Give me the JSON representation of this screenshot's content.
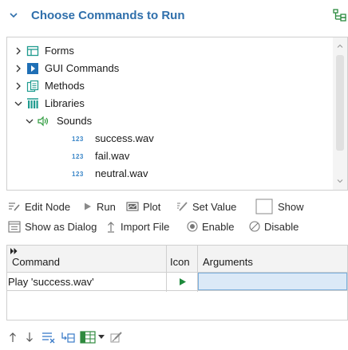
{
  "header": {
    "title": "Choose Commands to Run"
  },
  "tree": {
    "items": [
      {
        "label": "Forms",
        "icon": "forms-icon",
        "expanded": false
      },
      {
        "label": "GUI Commands",
        "icon": "gui-commands-icon",
        "expanded": false
      },
      {
        "label": "Methods",
        "icon": "methods-icon",
        "expanded": false
      },
      {
        "label": "Libraries",
        "icon": "libraries-icon",
        "expanded": true
      },
      {
        "label": "Sounds",
        "icon": "sounds-icon",
        "expanded": true
      },
      {
        "label": "success.wav",
        "badge": "123"
      },
      {
        "label": "fail.wav",
        "badge": "123"
      },
      {
        "label": "neutral.wav",
        "badge": "123"
      }
    ]
  },
  "toolbar": {
    "edit_node": "Edit Node",
    "run": "Run",
    "plot": "Plot",
    "set_value": "Set Value",
    "show": "Show",
    "show_as_dialog": "Show as Dialog",
    "import_file": "Import File",
    "enable": "Enable",
    "disable": "Disable"
  },
  "grid": {
    "columns": [
      "Command",
      "Icon",
      "Arguments"
    ],
    "rows": [
      {
        "command": "Play 'success.wav'",
        "icon": "play-icon",
        "arguments": ""
      }
    ]
  },
  "colors": {
    "accent": "#2f6fab",
    "play": "#1e8a3c",
    "selection": "#dbe9f7"
  }
}
